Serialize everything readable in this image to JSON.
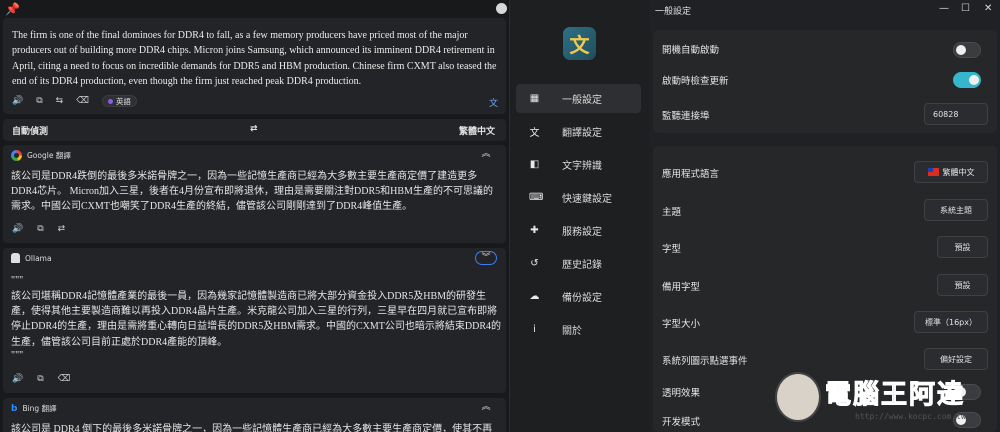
{
  "source": {
    "text": "The firm is one of the final dominoes for DDR4 to fall, as a few memory producers have priced most of the major producers out of building more DDR4 chips. Micron joins Samsung, which announced its imminent DDR4 retirement in April, citing a need to focus on incredible demands for DDR5 and HBM production. Chinese firm CXMT also teased the end of its DDR4 production, even though the firm just reached peak DDR4 production.",
    "detected_lang": "英語",
    "icons": [
      "speaker-icon",
      "copy-icon",
      "tts-icon",
      "clear-icon"
    ]
  },
  "lang_row": {
    "from": "自動偵測",
    "swap": "⇄",
    "to": "繁體中文"
  },
  "google": {
    "name": "Google 翻譯",
    "text": "該公司是DDR4跌倒的最後多米諾骨牌之一，因為一些記憶生產商已經為大多數主要生產商定價了建造更多DDR4芯片。 Micron加入三星，後者在4月份宣布即將退休，理由是需要關注對DDR5和HBM生產的不可思議的需求。中國公司CXMT也嘲笑了DDR4生產的終結，儘管該公司剛剛達到了DDR4峰值生產。"
  },
  "ollama": {
    "name": "Ollama",
    "quote_open": "\"\"\"",
    "text": "該公司堪稱DDR4記憶體產業的最後一員，因為幾家記憶體製造商已將大部分資金投入DDR5及HBM的研發生產，使得其他主要製造商難以再投入DDR4晶片生產。米克龍公司加入三星的行列，三星早在四月就已宣布即將停止DDR4的生產，理由是需將重心轉向日益增長的DDR5及HBM需求。中國的CXMT公司也暗示將結束DDR4的生產，儘管該公司目前正處於DDR4產能的頂峰。",
    "quote_close": "\"\"\""
  },
  "bing": {
    "name": "Bing 翻譯",
    "text": "該公司是 DDR4 倒下的最後多米諾骨牌之一，因為一些記憶體生產商已經為大多數主要生產商定價，使其不再"
  },
  "nav": {
    "items": [
      {
        "label": "一般設定",
        "icon": "▦"
      },
      {
        "label": "翻譯設定",
        "icon": "文"
      },
      {
        "label": "文字辨識",
        "icon": "◧"
      },
      {
        "label": "快速鍵設定",
        "icon": "⌨"
      },
      {
        "label": "服務設定",
        "icon": "✚"
      },
      {
        "label": "歷史記錄",
        "icon": "↺"
      },
      {
        "label": "備份設定",
        "icon": "☁"
      },
      {
        "label": "關於",
        "icon": "i"
      }
    ]
  },
  "settings": {
    "window_title": "一般設定",
    "controls": {
      "min": "—",
      "max": "☐",
      "close": "✕"
    },
    "auto_start": {
      "label": "開機自動啟動",
      "on": false
    },
    "check_update": {
      "label": "啟動時檢查更新",
      "on": true
    },
    "port": {
      "label": "監聽連接埠",
      "value": "60828"
    },
    "app_lang": {
      "label": "應用程式語言",
      "value": "繁體中文"
    },
    "theme": {
      "label": "主題",
      "value": "系統主題"
    },
    "font": {
      "label": "字型",
      "value": "預設"
    },
    "fallback_font": {
      "label": "備用字型",
      "value": "預設"
    },
    "font_size": {
      "label": "字型大小",
      "value": "標準（16px）"
    },
    "tray_event": {
      "label": "系統列圖示點選事件",
      "value": "偏好設定"
    },
    "transparency": {
      "label": "透明效果"
    },
    "dev_mode": {
      "label": "开发模式"
    }
  },
  "watermark": {
    "text": "電腦王阿達",
    "url": "http://www.kocpc.com.tw"
  },
  "colors": {
    "accent": "#35b6cc",
    "link_blue": "#4aa3ff",
    "bg": "#18191b"
  }
}
